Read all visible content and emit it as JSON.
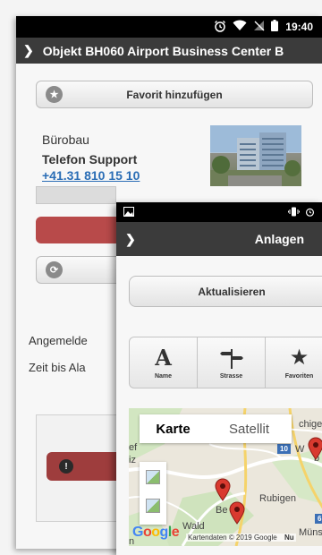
{
  "back_screen": {
    "status_bar": {
      "time": "19:40"
    },
    "header": {
      "title": "Objekt BH060 Airport Business Center B"
    },
    "favorite_button": {
      "label": "Favorit hinzufügen"
    },
    "object_type": "Bürobau",
    "phone_label": "Telefon Support",
    "phone_number": "+41.31 810 15 10",
    "logged_in_label": "Angemelde",
    "alarm_time_label": "Zeit bis Ala"
  },
  "front_screen": {
    "header": {
      "title": "Anlagen"
    },
    "update_button": {
      "label": "Aktualisieren"
    },
    "nav": [
      {
        "label": "Name",
        "icon": "letter-a-icon"
      },
      {
        "label": "Strasse",
        "icon": "signpost-icon"
      },
      {
        "label": "Favoriten",
        "icon": "star-icon"
      }
    ],
    "map": {
      "type_toggle": {
        "map_label": "Karte",
        "satellite_label": "Satellit"
      },
      "place_labels": [
        "Rubigen",
        "Münsinge",
        "Wald",
        "Be",
        "chigen",
        "W",
        "b",
        "iz",
        "ef",
        "n"
      ],
      "road_shields": [
        "10",
        "6"
      ],
      "google_logo": "Google",
      "attribution": "Kartendaten © 2019 Google",
      "attribution_more": "Nu"
    },
    "colors": {
      "header": "#3b3b3b",
      "pin": "#d93a2f",
      "accent_link": "#2a6db5"
    }
  }
}
